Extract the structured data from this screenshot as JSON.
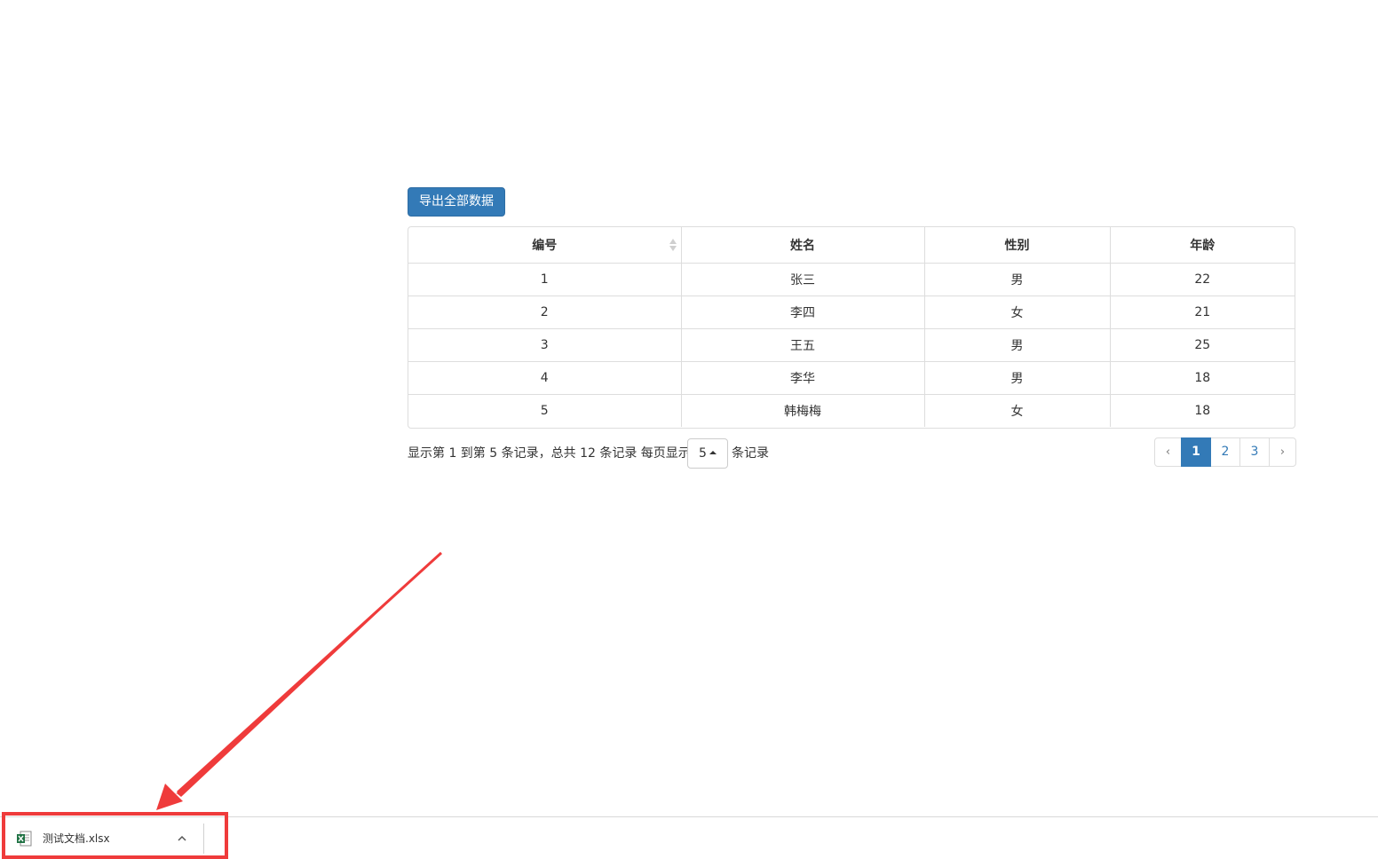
{
  "toolbar": {
    "export_label": "导出全部数据"
  },
  "table": {
    "columns": [
      "编号",
      "姓名",
      "性别",
      "年龄"
    ],
    "rows": [
      [
        "1",
        "张三",
        "男",
        "22"
      ],
      [
        "2",
        "李四",
        "女",
        "21"
      ],
      [
        "3",
        "王五",
        "男",
        "25"
      ],
      [
        "4",
        "李华",
        "男",
        "18"
      ],
      [
        "5",
        "韩梅梅",
        "女",
        "18"
      ]
    ]
  },
  "pager": {
    "info": "显示第 1 到第 5 条记录，总共 12 条记录 每页显示",
    "page_size": "5",
    "suffix": "条记录",
    "prev": "‹",
    "pages": [
      "1",
      "2",
      "3"
    ],
    "active_page": "1",
    "next": "›"
  },
  "download_bar": {
    "file_name": "测试文档.xlsx",
    "file_icon": "excel-file-icon",
    "expand_icon": "chevron-up-icon"
  },
  "colors": {
    "primary": "#337ab7",
    "annotation": "#ef3b3b"
  }
}
